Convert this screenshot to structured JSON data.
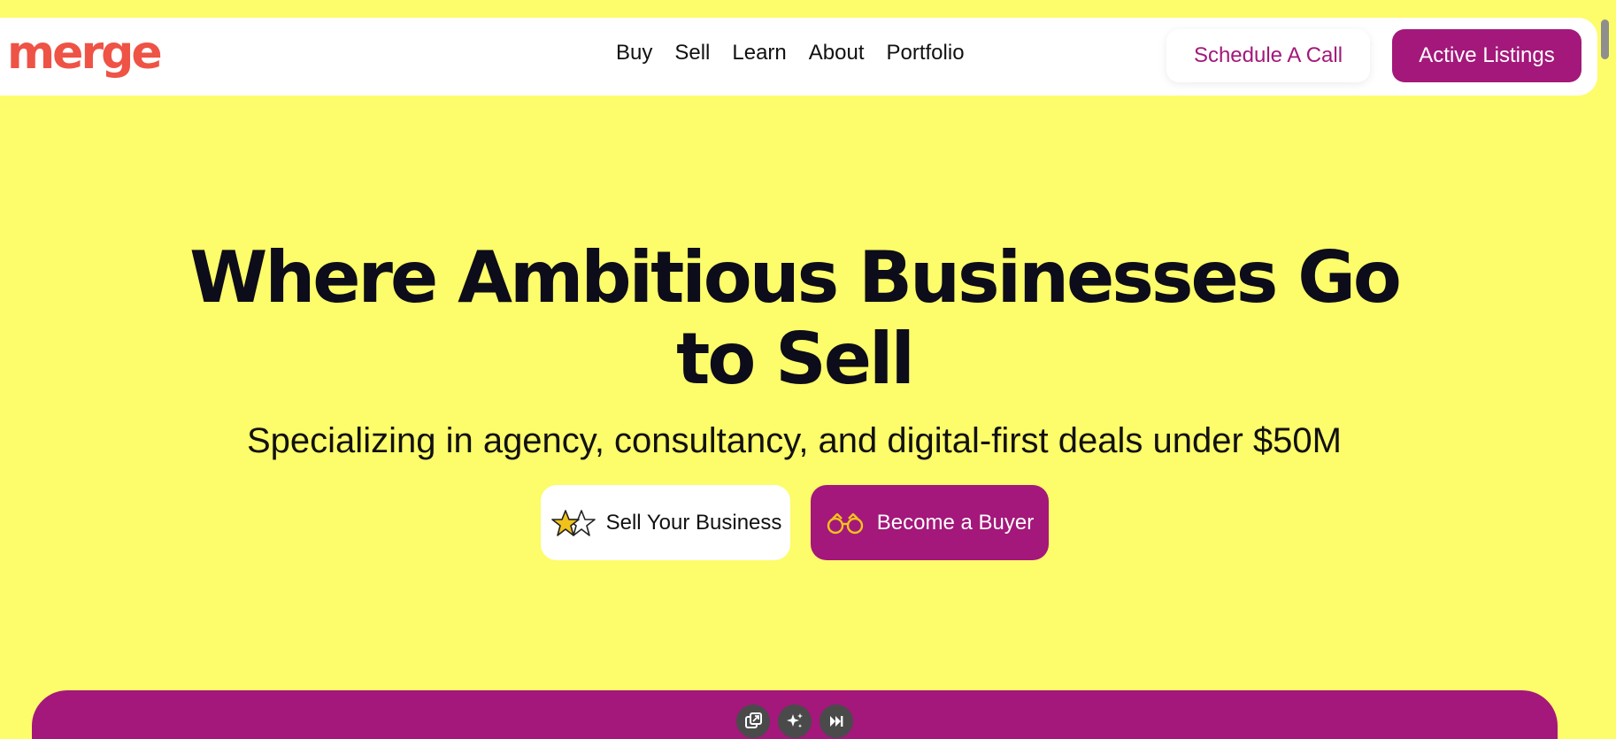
{
  "brand": {
    "logo_text": "merge",
    "logo_color": "#ee5345",
    "accent_color": "#a3187a",
    "background_color": "#fdfc6a"
  },
  "nav": {
    "links": [
      {
        "label": "Buy"
      },
      {
        "label": "Sell"
      },
      {
        "label": "Learn"
      },
      {
        "label": "About"
      },
      {
        "label": "Portfolio"
      }
    ],
    "schedule_label": "Schedule A Call",
    "listings_label": "Active Listings"
  },
  "hero": {
    "title_line1": "Where Ambitious Businesses Go",
    "title_line2": "to Sell",
    "subtitle": "Specializing in agency, consultancy, and digital-first deals under $50M",
    "sell_button": {
      "label": "Sell Your Business",
      "icon": "stars-icon"
    },
    "buyer_button": {
      "label": "Become a Buyer",
      "icon": "binoculars-icon"
    }
  },
  "media_controls": [
    {
      "icon": "picture-in-picture-icon"
    },
    {
      "icon": "sparkle-icon"
    },
    {
      "icon": "skip-next-icon"
    }
  ]
}
